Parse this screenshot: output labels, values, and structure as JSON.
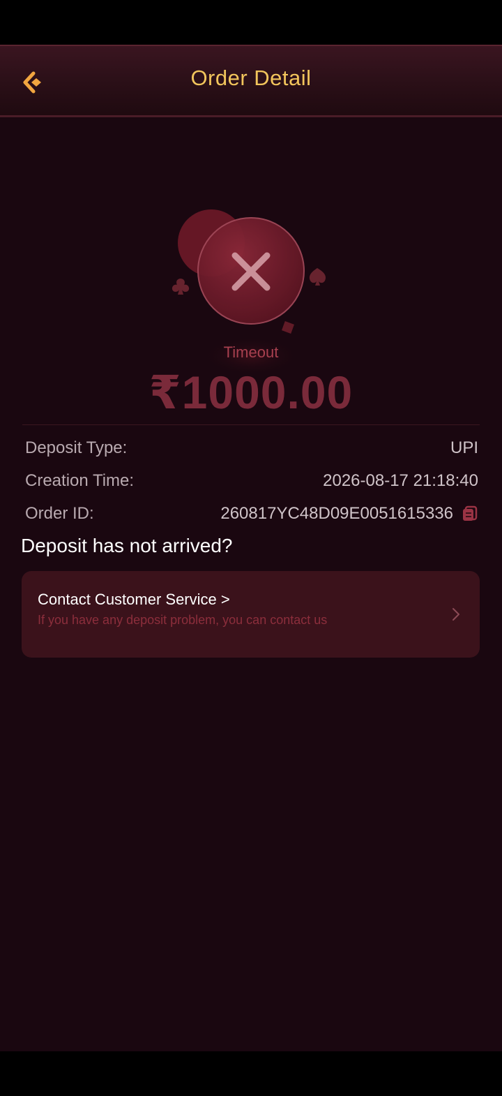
{
  "header": {
    "title": "Order Detail",
    "back_icon": "back-arrow-icon"
  },
  "status": {
    "icon": "failed-x-icon",
    "label": "Timeout",
    "amount": "₹1000.00"
  },
  "details": {
    "deposit_type_label": "Deposit Type:",
    "deposit_type_value": "UPI",
    "creation_time_label": "Creation Time:",
    "creation_time_value": "2026-08-17 21:18:40",
    "order_id_label": "Order ID:",
    "order_id_value": "260817YC48D09E0051615336",
    "copy_icon": "copy-icon"
  },
  "help": {
    "title": "Deposit has not arrived?",
    "service_title": "Contact Customer Service >",
    "service_subtitle": "If you have any deposit problem, you can contact us",
    "chevron_icon": "chevron-right-icon"
  },
  "colors": {
    "background": "#1a0710",
    "accent_gold": "#f2c55c",
    "failed_red": "#a8404f",
    "card_bg": "#3b121b"
  }
}
